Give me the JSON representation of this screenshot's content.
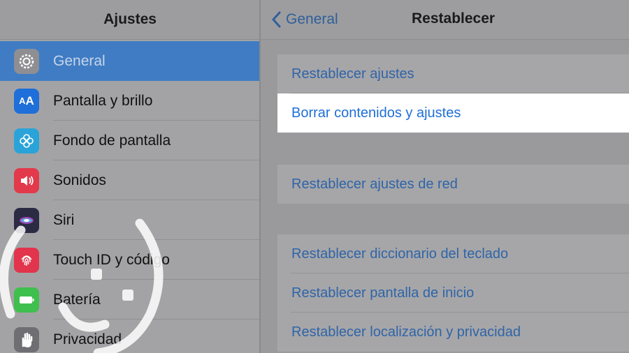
{
  "sidebar": {
    "title": "Ajustes",
    "items": [
      {
        "label": "General",
        "icon": "gear-icon",
        "color": "#8e8e93",
        "selected": true
      },
      {
        "label": "Pantalla y brillo",
        "icon": "display-icon",
        "color": "#1e6fd9"
      },
      {
        "label": "Fondo de pantalla",
        "icon": "wallpaper-icon",
        "color": "#2aa3d8"
      },
      {
        "label": "Sonidos",
        "icon": "speaker-icon",
        "color": "#e23a4a"
      },
      {
        "label": "Siri",
        "icon": "siri-icon",
        "color": "#2b2b44"
      },
      {
        "label": "Touch ID y código",
        "icon": "fingerprint-icon",
        "color": "#e2344d"
      },
      {
        "label": "Batería",
        "icon": "battery-icon",
        "color": "#3fbf4d"
      },
      {
        "label": "Privacidad",
        "icon": "hand-icon",
        "color": "#6e6e73"
      }
    ]
  },
  "header": {
    "back_label": "General",
    "title": "Restablecer"
  },
  "groups": [
    {
      "rows": [
        "Restablecer ajustes",
        "Borrar contenidos y ajustes"
      ]
    },
    {
      "rows": [
        "Restablecer ajustes de red"
      ]
    },
    {
      "rows": [
        "Restablecer diccionario del teclado",
        "Restablecer pantalla de inicio",
        "Restablecer localización y privacidad"
      ]
    }
  ],
  "highlighted_row": "Borrar contenidos y ajustes",
  "colors": {
    "accent": "#1f6fd6",
    "selected": "#3f7cc4"
  }
}
